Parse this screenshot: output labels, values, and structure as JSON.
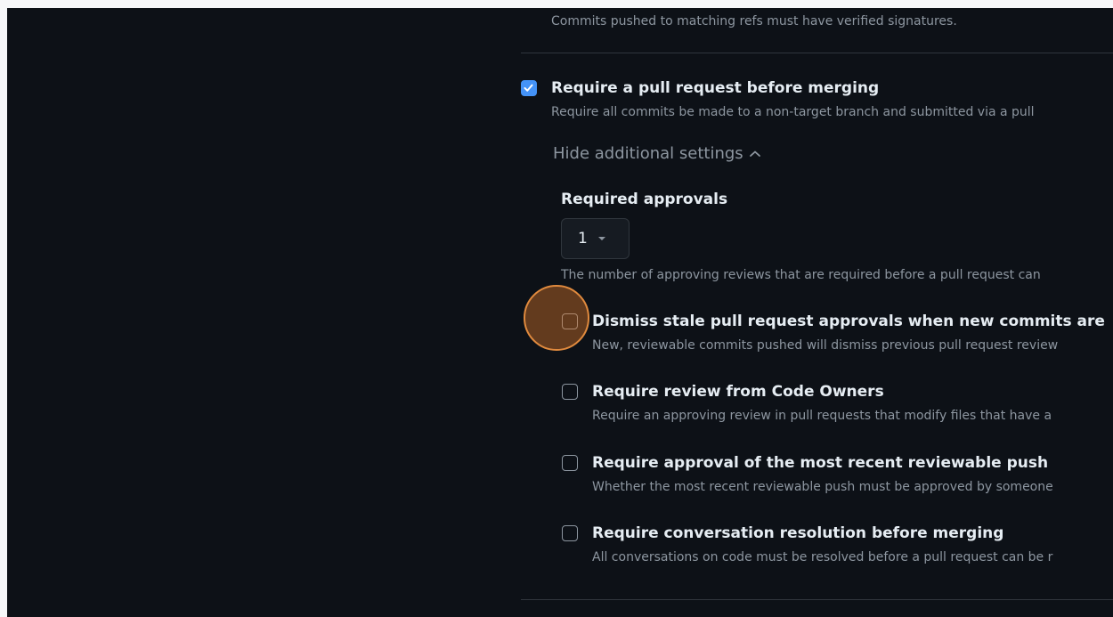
{
  "rules": {
    "signed_commits_desc": "Commits pushed to matching refs must have verified signatures.",
    "require_pr": {
      "label": "Require a pull request before merging",
      "description": "Require all commits be made to a non-target branch and submitted via a pull",
      "checked": true
    },
    "additional_settings_toggle": "Hide additional settings",
    "required_approvals": {
      "label": "Required approvals",
      "value": "1",
      "help": "The number of approving reviews that are required before a pull request can"
    },
    "options": [
      {
        "label": "Dismiss stale pull request approvals when new commits are",
        "description": "New, reviewable commits pushed will dismiss previous pull request review",
        "checked": false
      },
      {
        "label": "Require review from Code Owners",
        "description": "Require an approving review in pull requests that modify files that have a",
        "checked": false
      },
      {
        "label": "Require approval of the most recent reviewable push",
        "description": "Whether the most recent reviewable push must be approved by someone",
        "checked": false
      },
      {
        "label": "Require conversation resolution before merging",
        "description": "All conversations on code must be resolved before a pull request can be r",
        "checked": false
      }
    ]
  },
  "colors": {
    "background": "#0d1117",
    "accent": "#4493f8",
    "click_indicator": "#e08a3e"
  }
}
